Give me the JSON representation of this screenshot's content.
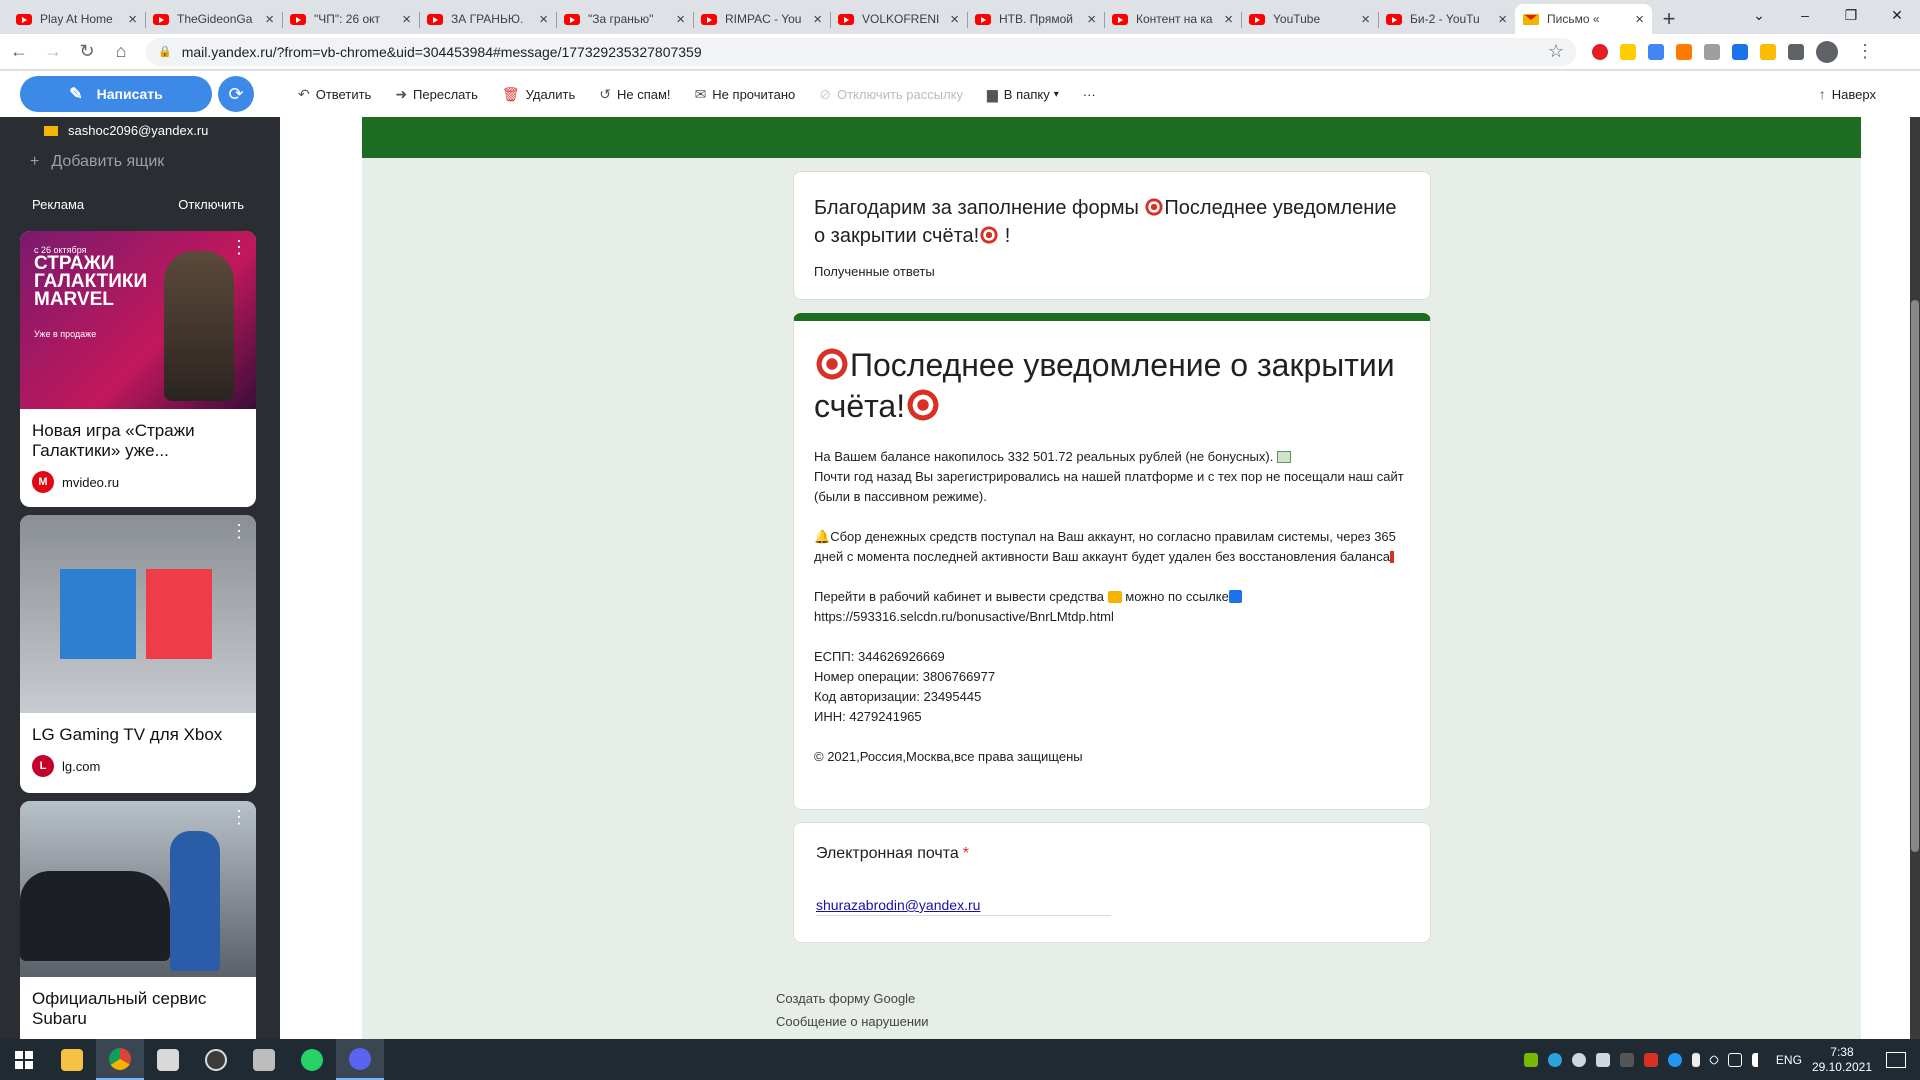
{
  "browser": {
    "tabs": [
      {
        "title": "Play At Home",
        "type": "youtube"
      },
      {
        "title": "TheGideonGa",
        "type": "youtube"
      },
      {
        "title": "\"ЧП\": 26 окт",
        "type": "youtube"
      },
      {
        "title": "ЗА ГРАНЬЮ.",
        "type": "youtube"
      },
      {
        "title": "\"За гранью\"",
        "type": "youtube"
      },
      {
        "title": "RIMPAC - You",
        "type": "youtube"
      },
      {
        "title": "VOLKOFRENI",
        "type": "youtube"
      },
      {
        "title": "НТВ. Прямой",
        "type": "youtube"
      },
      {
        "title": "Контент на ка",
        "type": "youtube"
      },
      {
        "title": "YouTube",
        "type": "youtube"
      },
      {
        "title": "Би-2 - YouTu",
        "type": "youtube"
      },
      {
        "title": "Письмо «",
        "type": "mail",
        "active": true
      }
    ],
    "new_tab": "+",
    "close_glyph": "×",
    "url": "mail.yandex.ru/?from=vb-chrome&uid=304453984#message/177329235327807359"
  },
  "toolbar": {
    "compose": "Написать",
    "reply": "Ответить",
    "forward": "Переслать",
    "delete": "Удалить",
    "not_spam": "Не спам!",
    "unread": "Не прочитано",
    "unsubscribe": "Отключить рассылку",
    "to_folder": "В папку",
    "more": "···",
    "up": "Наверх"
  },
  "sidebar": {
    "account": "sashoc2096@yandex.ru",
    "add_box": "Добавить ящик",
    "ads_label": "Реклама",
    "ads_disable": "Отключить",
    "ads": [
      {
        "promo_small": "с 26 октября",
        "promo_big": "СТРАЖИ ГАЛАКТИКИ MARVEL",
        "promo_sub": "Уже в продаже",
        "title": "Новая игра «Стражи Галактики» уже...",
        "source": "mvideo.ru",
        "logo_color": "#e30613"
      },
      {
        "title": "LG Gaming TV для Xbox",
        "source": "lg.com",
        "logo_color": "#c4002d"
      },
      {
        "title": "Официальный сервис Subaru",
        "source": "",
        "logo_color": "#1e3a6b"
      }
    ]
  },
  "form": {
    "header_title": "Благодарим за заполнение формы",
    "header_title_tail": "Последнее уведомление о закрытии счёта!",
    "header_title_end": " !",
    "header_sub": "Полученные ответы",
    "title": "Последнее уведомление о закрытии счёта!",
    "body": [
      "На Вашем балансе накопилось 332 501.72 реальных рублей (не бонусных).",
      "Почти год назад Вы зарегистрировались на нашей платформе и с тех пор не посещали наш сайт (были в пассивном режиме).",
      "",
      "Сбор денежных средств поступал на Ваш аккаунт, но согласно правилам системы, через 365 дней с момента последней активности Ваш аккаунт будет удален без восстановления баланса",
      "",
      "Перейти в рабочий кабинет и вывести средства",
      "можно по ссылке",
      "https://593316.selcdn.ru/bonusactive/BnrLMtdp.html",
      "",
      "ЕСПП: 344626926669",
      "Номер операции: 3806766977",
      "Код авторизации: 23495445",
      "ИНН: 4279241965",
      "",
      "© 2021,Россия,Москва,все права защищены"
    ],
    "email_label": "Электронная почта",
    "email_required": "*",
    "email_value": "shurazabrodin@yandex.ru",
    "footer_links": [
      "Создать форму Google",
      "Сообщение о нарушении"
    ]
  },
  "taskbar": {
    "lang": "ENG",
    "time": "7:38",
    "date": "29.10.2021"
  },
  "colors": {
    "accent_blue": "#3d89e8",
    "form_green": "#1e6b22",
    "form_bg": "#e7ede7"
  }
}
